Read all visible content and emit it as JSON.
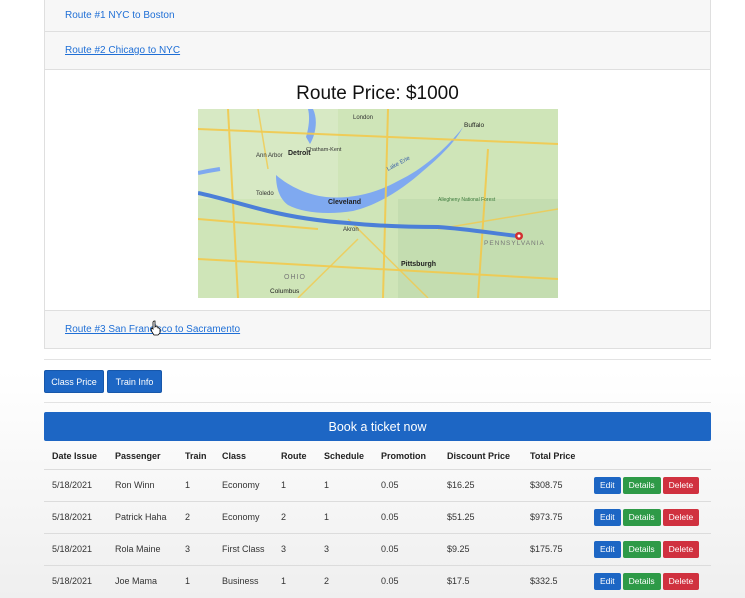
{
  "routes": [
    {
      "label": "Route #1 NYC to Boston"
    },
    {
      "label": "Route #2 Chicago to NYC",
      "price_label": "Route Price: $1000"
    },
    {
      "label": "Route #3 San Francisco to Sacramento"
    }
  ],
  "map": {
    "labels": {
      "detroit": "Detroit",
      "ann_arbor": "Ann Arbor",
      "toledo": "Toledo",
      "cleveland": "Cleveland",
      "akron": "Akron",
      "pittsburgh": "Pittsburgh",
      "columbus": "Columbus",
      "ohio": "OHIO",
      "pennsylvania": "PENNSYLVANIA",
      "buffalo": "Buffalo",
      "london": "London",
      "chatham": "Chatham-Kent",
      "lake_erie": "Lake Erie",
      "allegheny": "Allegheny National Forest"
    },
    "colors": {
      "land": "#cfe5b8",
      "water": "#7fa9f0",
      "road": "#f2c94c",
      "route": "#4b7fd8"
    }
  },
  "buttons": {
    "class_price": "Class Price",
    "train_info": "Train Info"
  },
  "book_label": "Book a ticket now",
  "table": {
    "headers": [
      "Date Issue",
      "Passenger",
      "Train",
      "Class",
      "Route",
      "Schedule",
      "Promotion",
      "Discount Price",
      "Total Price"
    ],
    "rows": [
      [
        "5/18/2021",
        "Ron Winn",
        "1",
        "Economy",
        "1",
        "1",
        "0.05",
        "$16.25",
        "$308.75"
      ],
      [
        "5/18/2021",
        "Patrick Haha",
        "2",
        "Economy",
        "2",
        "1",
        "0.05",
        "$51.25",
        "$973.75"
      ],
      [
        "5/18/2021",
        "Rola Maine",
        "3",
        "First Class",
        "3",
        "3",
        "0.05",
        "$9.25",
        "$175.75"
      ],
      [
        "5/18/2021",
        "Joe Mama",
        "1",
        "Business",
        "1",
        "2",
        "0.05",
        "$17.5",
        "$332.5"
      ]
    ],
    "actions": {
      "edit": "Edit",
      "details": "Details",
      "delete": "Delete"
    }
  }
}
